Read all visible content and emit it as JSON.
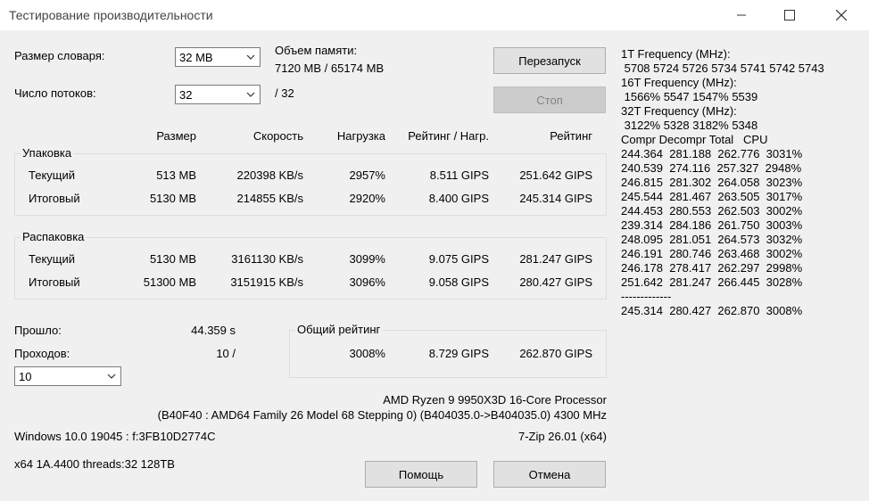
{
  "window": {
    "title": "Тестирование производительности"
  },
  "settings": {
    "dict_label": "Размер словаря:",
    "dict_value": "32 MB",
    "threads_label": "Число потоков:",
    "threads_value": "32",
    "threads_max": "/ 32",
    "memory_label": "Объем памяти:",
    "memory_value": "7120 MB / 65174 MB"
  },
  "buttons": {
    "restart": "Перезапуск",
    "stop": "Стоп",
    "help": "Помощь",
    "cancel": "Отмена"
  },
  "columns": {
    "size": "Размер",
    "speed": "Скорость",
    "load": "Нагрузка",
    "rating_load": "Рейтинг / Нагр.",
    "rating": "Рейтинг"
  },
  "compress": {
    "label": "Упаковка",
    "current": {
      "label": "Текущий",
      "size": "513 MB",
      "speed": "220398 KB/s",
      "load": "2957%",
      "rating_load": "8.511 GIPS",
      "rating": "251.642 GIPS"
    },
    "total": {
      "label": "Итоговый",
      "size": "5130 MB",
      "speed": "214855 KB/s",
      "load": "2920%",
      "rating_load": "8.400 GIPS",
      "rating": "245.314 GIPS"
    }
  },
  "decompress": {
    "label": "Распаковка",
    "current": {
      "label": "Текущий",
      "size": "5130 MB",
      "speed": "3161130 KB/s",
      "load": "3099%",
      "rating_load": "9.075 GIPS",
      "rating": "281.247 GIPS"
    },
    "total": {
      "label": "Итоговый",
      "size": "51300 MB",
      "speed": "3151915 KB/s",
      "load": "3096%",
      "rating_load": "9.058 GIPS",
      "rating": "280.427 GIPS"
    }
  },
  "elapsed": {
    "label": "Прошло:",
    "value": "44.359 s"
  },
  "passes": {
    "label": "Проходов:",
    "value": "10 /",
    "select_value": "10"
  },
  "overall": {
    "label": "Общий рейтинг",
    "load": "3008%",
    "rating_load": "8.729 GIPS",
    "rating": "262.870 GIPS"
  },
  "cpu": {
    "name": "AMD Ryzen 9 9950X3D 16-Core Processor",
    "details": "(B40F40 : AMD64 Family 26 Model 68 Stepping 0) (B404035.0->B404035.0) 4300 MHz"
  },
  "system": {
    "os": "Windows 10.0 19045 :  f:3FB10D2774C",
    "version": "7-Zip 26.01 (x64)",
    "build": "x64 1A.4400 threads:32 128TB"
  },
  "log": [
    "1T Frequency (MHz):",
    " 5708 5724 5726 5734 5741 5742 5743",
    "16T Frequency (MHz):",
    " 1566% 5547 1547% 5539",
    "32T Frequency (MHz):",
    " 3122% 5328 3182% 5348",
    "Compr Decompr Total   CPU",
    "244.364  281.188  262.776  3031%",
    "240.539  274.116  257.327  2948%",
    "246.815  281.302  264.058  3023%",
    "245.544  281.467  263.505  3017%",
    "244.453  280.553  262.503  3002%",
    "239.314  284.186  261.750  3003%",
    "248.095  281.051  264.573  3032%",
    "246.191  280.746  263.468  3002%",
    "246.178  278.417  262.297  2998%",
    "251.642  281.247  266.445  3028%",
    "-------------",
    "245.314  280.427  262.870  3008%"
  ]
}
